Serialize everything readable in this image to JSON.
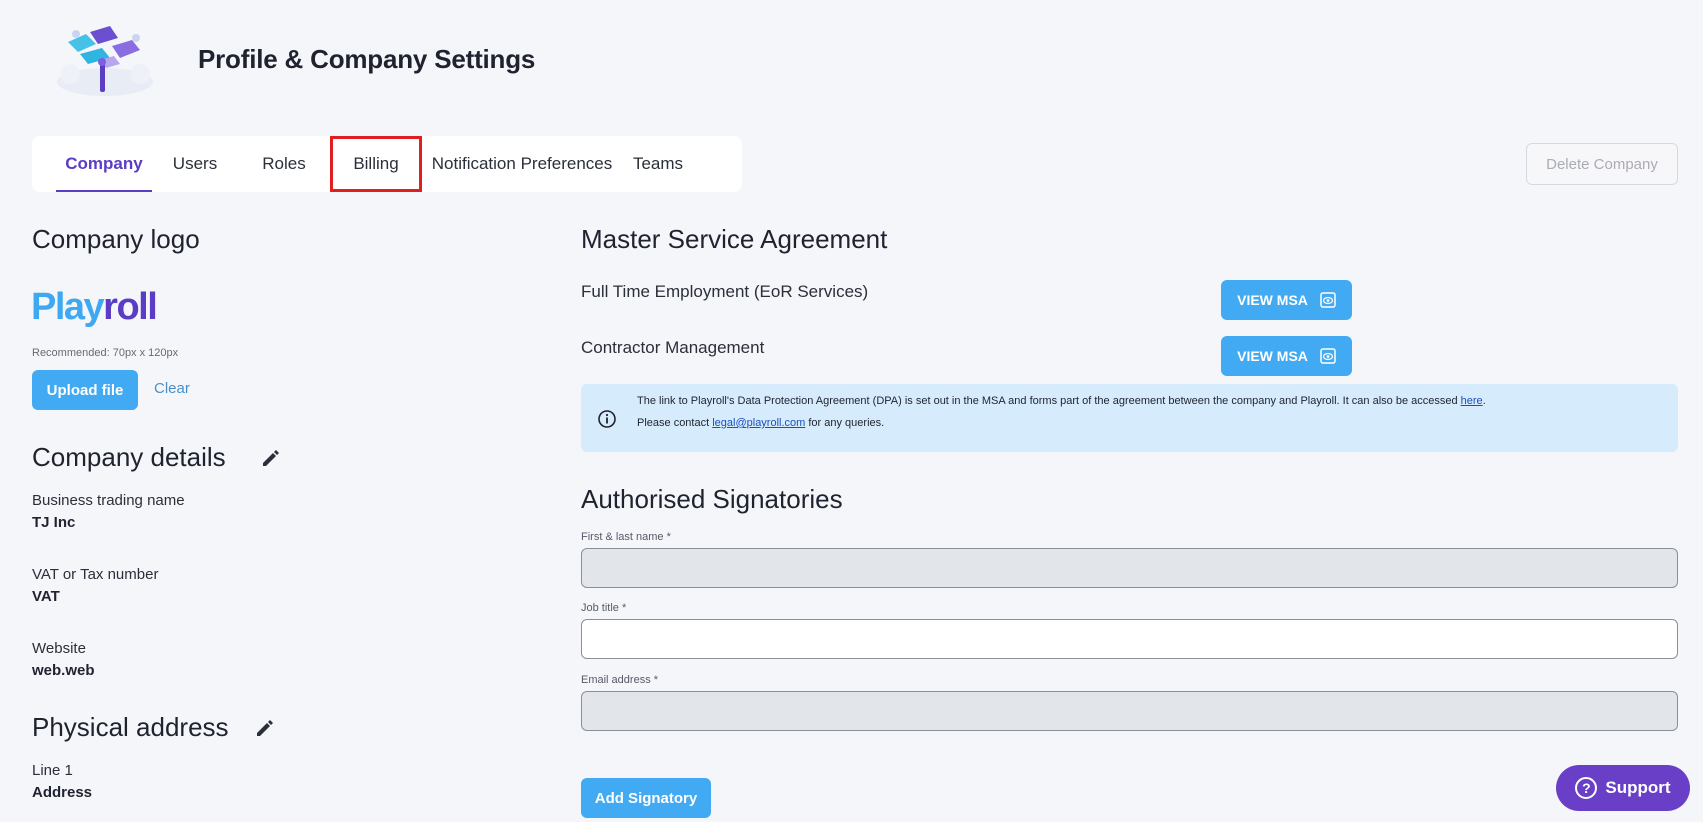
{
  "header": {
    "title": "Profile & Company Settings"
  },
  "tabs": [
    {
      "label": "Company",
      "active": true
    },
    {
      "label": "Users"
    },
    {
      "label": "Roles"
    },
    {
      "label": "Billing",
      "highlighted": true
    },
    {
      "label": "Notification Preferences"
    },
    {
      "label": "Teams"
    }
  ],
  "delete_label": "Delete Company",
  "logo_section": {
    "title": "Company logo",
    "logo_part1": "Play",
    "logo_part2": "roll",
    "recommended": "Recommended: 70px x 120px",
    "upload_label": "Upload file",
    "clear_label": "Clear"
  },
  "company_details": {
    "title": "Company details",
    "fields": [
      {
        "label": "Business trading name",
        "value": "TJ Inc"
      },
      {
        "label": "VAT or Tax number",
        "value": "VAT"
      },
      {
        "label": "Website",
        "value": "web.web"
      }
    ]
  },
  "physical_address": {
    "title": "Physical address",
    "line1_label": "Line 1",
    "line1_value": "Address"
  },
  "msa": {
    "title": "Master Service Agreement",
    "rows": [
      {
        "label": "Full Time Employment (EoR Services)",
        "button": "VIEW MSA"
      },
      {
        "label": "Contractor Management",
        "button": "VIEW MSA"
      }
    ],
    "info_line1": "The link to Playroll's Data Protection Agreement (DPA) is set out in the MSA and forms part of the agreement between the company and Playroll. It can also be accessed ",
    "info_link1": "here",
    "info_line1_end": ".",
    "info_line2": "Please contact ",
    "info_link2": "legal@playroll.com",
    "info_line2_end": " for any queries."
  },
  "signatories": {
    "title": "Authorised Signatories",
    "name_label": "First & last name *",
    "job_label": "Job title *",
    "email_label": "Email address *",
    "add_label": "Add Signatory"
  },
  "support_label": "Support",
  "colors": {
    "accent": "#5b3cc4",
    "primary_button": "#42aaf2",
    "info_bg": "#d6ebfb",
    "highlight": "#e02020"
  }
}
